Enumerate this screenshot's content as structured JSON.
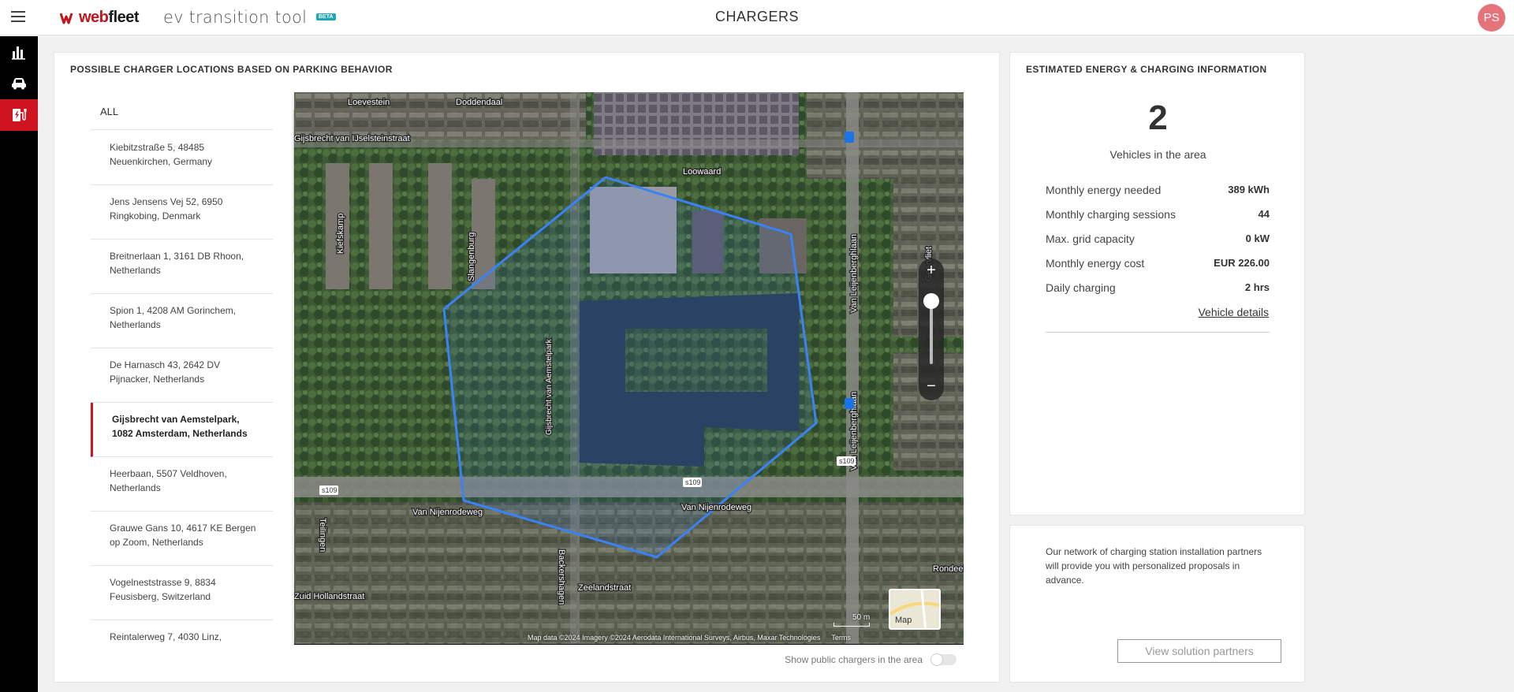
{
  "header": {
    "brand_prefix": "web",
    "brand_suffix": "fleet",
    "app_title": "ev transition tool",
    "beta_badge": "BETA",
    "page_title": "CHARGERS",
    "user_initials": "PS"
  },
  "sidenav": {
    "items": [
      {
        "icon": "bar-chart-icon"
      },
      {
        "icon": "car-icon"
      },
      {
        "icon": "ev-charger-icon",
        "active": true
      }
    ]
  },
  "locations": {
    "title": "POSSIBLE CHARGER LOCATIONS BASED ON PARKING BEHAVIOR",
    "all_label": "ALL",
    "items": [
      {
        "line1": "Kiebitzstraße 5, 48485",
        "line2": "Neuenkirchen, Germany"
      },
      {
        "line1": "Jens Jensens Vej 52, 6950",
        "line2": "Ringkobing, Denmark"
      },
      {
        "line1": "Breitnerlaan 1, 3161 DB Rhoon,",
        "line2": "Netherlands"
      },
      {
        "line1": "Spion 1, 4208 AM Gorinchem,",
        "line2": "Netherlands"
      },
      {
        "line1": "De Harnasch 43, 2642 DV",
        "line2": "Pijnacker, Netherlands"
      },
      {
        "line1": "Gijsbrecht van Aemstelpark,",
        "line2": "1082 Amsterdam, Netherlands",
        "selected": true
      },
      {
        "line1": "Heerbaan, 5507 Veldhoven,",
        "line2": "Netherlands"
      },
      {
        "line1": "Grauwe Gans 10, 4617 KE Bergen",
        "line2": "op Zoom, Netherlands"
      },
      {
        "line1": "Vogelneststrasse 9, 8834",
        "line2": "Feusisberg, Switzerland"
      },
      {
        "line1": "Reintalerweg 7, 4030 Linz,",
        "line2": ""
      }
    ]
  },
  "map": {
    "street_labels": [
      "Loevestein",
      "Doddendaal",
      "Gijsbrecht van IJselsteinstraat",
      "Loowaard",
      "Kiefskamp",
      "Slangenburg",
      "Van Leijenberghlaan",
      "Geervliet",
      "Gijsbrecht van Aemstelpark",
      "Van Nijenrodeweg",
      "Van Nijenrodeweg",
      "Backershagen",
      "Zeelandstraat",
      "Zuid Hollandstraat",
      "Teilingen",
      "Rondeel"
    ],
    "road_badges": [
      "s109",
      "s109",
      "s109"
    ],
    "zoom_in": "+",
    "zoom_out": "−",
    "scale_label": "50 m",
    "type_label": "Map",
    "attribution": "Map data ©2024 Imagery ©2024 Aerodata International Surveys, Airbus, Maxar Technologies",
    "terms": "Terms",
    "polygon_color": "#3b82f6"
  },
  "public_chargers_toggle": {
    "label": "Show public chargers in the area",
    "on": false
  },
  "energy": {
    "title": "ESTIMATED ENERGY & CHARGING INFORMATION",
    "vehicles_count": "2",
    "vehicles_label": "Vehicles in the area",
    "stats": [
      {
        "label": "Monthly energy needed",
        "value": "389 kWh"
      },
      {
        "label": "Monthly charging sessions",
        "value": "44"
      },
      {
        "label": "Max. grid capacity",
        "value": "0 kW"
      },
      {
        "label": "Monthly energy cost",
        "value": "EUR 226.00"
      },
      {
        "label": "Daily charging",
        "value": "2 hrs"
      }
    ],
    "vehicle_details_link": "Vehicle details"
  },
  "partners": {
    "text": "Our network of charging station installation partners will provide you with personalized proposals in advance.",
    "button": "View solution partners"
  },
  "colors": {
    "brand_red": "#d0141f",
    "sidenav_bg": "#000000",
    "beta_teal": "#1ba7ba",
    "avatar_pink": "#e7737a"
  }
}
